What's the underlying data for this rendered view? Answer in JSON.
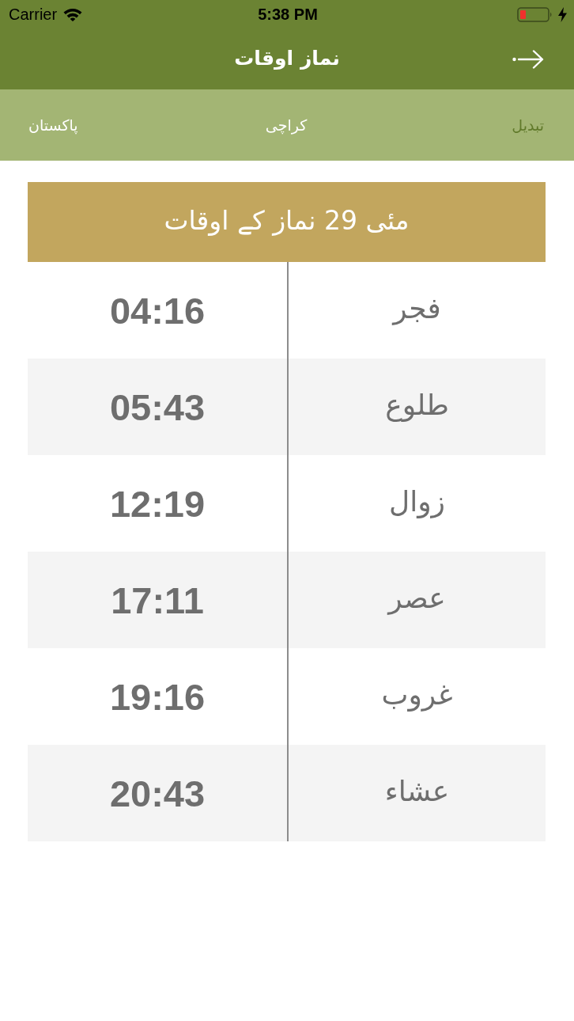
{
  "status_bar": {
    "carrier": "Carrier",
    "time": "5:38 PM"
  },
  "nav_bar": {
    "title": "نماز اوقات"
  },
  "location_bar": {
    "country": "پاکستان",
    "city": "کراچی",
    "change_label": "تبدیل"
  },
  "timetable": {
    "heading": "مئی 29 نماز کے اوقات",
    "rows": [
      {
        "name": "فجر",
        "time": "04:16"
      },
      {
        "name": "طلوع",
        "time": "05:43"
      },
      {
        "name": "زوال",
        "time": "12:19"
      },
      {
        "name": "عصر",
        "time": "17:11"
      },
      {
        "name": "غروب",
        "time": "19:16"
      },
      {
        "name": "عشاء",
        "time": "20:43"
      }
    ]
  }
}
